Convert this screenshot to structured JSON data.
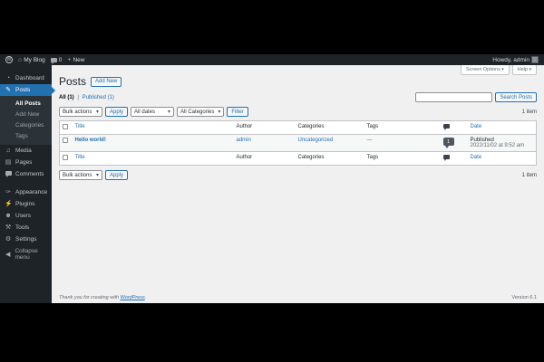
{
  "colors": {
    "accent": "#2271b1",
    "adminbar_bg": "#1d2327",
    "page_bg": "#f0f0f1",
    "border": "#c3c4c7"
  },
  "admin_bar": {
    "wp_logo": "W",
    "home_glyph": "⌂",
    "site_name": "My Blog",
    "comment_count": "0",
    "new_glyph": "+",
    "new_label": "New",
    "howdy": "Howdy, admin"
  },
  "sidebar": {
    "items": [
      {
        "label": "Dashboard",
        "glyph": "◔"
      },
      {
        "label": "Posts",
        "glyph": "✎"
      },
      {
        "label": "Media",
        "glyph": "♫"
      },
      {
        "label": "Pages",
        "glyph": "▤"
      },
      {
        "label": "Comments",
        "glyph": ""
      },
      {
        "label": "Appearance",
        "glyph": "✑"
      },
      {
        "label": "Plugins",
        "glyph": "⚡"
      },
      {
        "label": "Users",
        "glyph": "☻"
      },
      {
        "label": "Tools",
        "glyph": "⚒"
      },
      {
        "label": "Settings",
        "glyph": "⚙"
      }
    ],
    "posts_submenu": [
      {
        "label": "All Posts"
      },
      {
        "label": "Add New"
      },
      {
        "label": "Categories"
      },
      {
        "label": "Tags"
      }
    ],
    "collapse_glyph": "◀",
    "collapse_label": "Collapse menu"
  },
  "toolbar_tabs": {
    "screen_options": "Screen Options",
    "help": "Help"
  },
  "page": {
    "title": "Posts",
    "add_new": "Add New",
    "filter_all": "All (1)",
    "filter_sep": "|",
    "filter_published": "Published (1)",
    "search_button": "Search Posts",
    "item_count": "1 item"
  },
  "filters": {
    "bulk_actions": "Bulk actions",
    "apply": "Apply",
    "all_dates": "All dates",
    "all_categories": "All Categories",
    "filter": "Filter"
  },
  "table": {
    "headers": {
      "title": "Title",
      "author": "Author",
      "categories": "Categories",
      "tags": "Tags",
      "date": "Date"
    },
    "row": {
      "title": "Hello world!",
      "author": "admin",
      "categories": "Uncategorized",
      "tags": "—",
      "comment_count": "1",
      "date_status": "Published",
      "date_value": "2022/11/02 at 9:52 am"
    }
  },
  "footer": {
    "thanks_prefix": "Thank you for creating with ",
    "wordpress_link": "WordPress",
    "thanks_suffix": ".",
    "version": "Version 6.1"
  }
}
